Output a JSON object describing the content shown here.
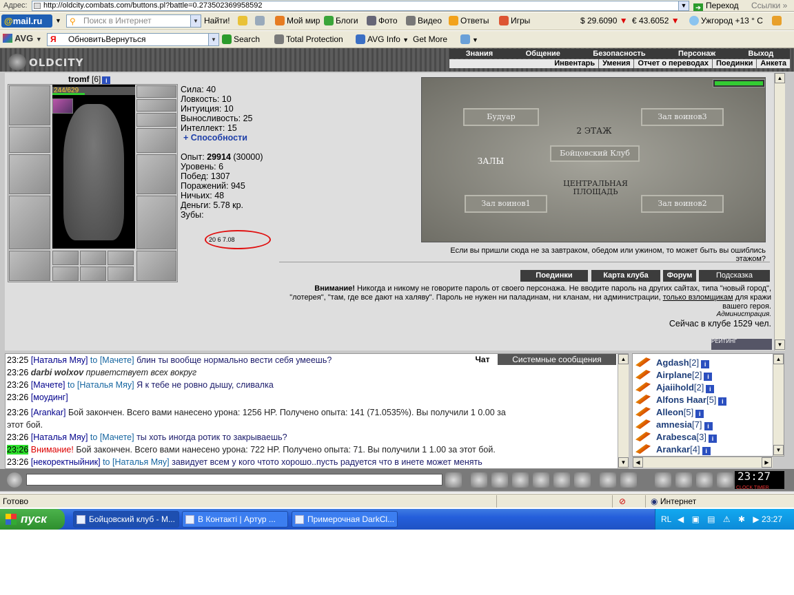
{
  "browser": {
    "address_label": "Адрес:",
    "url": "http://oldcity.combats.com/buttons.pl?battle=0.273502369958592",
    "go_label": "Переход",
    "links_label": "Ссылки"
  },
  "toolbar1": {
    "mailru_text": "mail.ru",
    "search_placeholder": "Поиск в Интернет",
    "find_button": "Найти!",
    "items": [
      "Мой мир",
      "Блоги",
      "Фото",
      "Видео",
      "Ответы",
      "Игры"
    ],
    "usd": "$ 29.6090",
    "eur": "€ 43.6052",
    "weather": "Ужгород +13 ° C"
  },
  "toolbar2": {
    "avg": "AVG",
    "yandex_text": "ОбновитьВернуться",
    "search": "Search",
    "total_protection": "Total Protection",
    "avg_info": "AVG Info",
    "get_more": "Get More"
  },
  "game": {
    "logo": "OLDCITY",
    "top_nav": [
      "Знания",
      "Общение",
      "Безопасность",
      "Персонаж",
      "Выход"
    ],
    "sub_nav": [
      "Инвентарь",
      "Умения",
      "Отчет о переводах",
      "Поединки",
      "Анкета"
    ],
    "character": {
      "name": "tromf",
      "level_tag": "[6]",
      "hp": "244/629",
      "hp_fraction": 0.388,
      "stats": [
        "Сила: 40",
        "Ловкость: 10",
        "Интуиция: 10",
        "Выносливость: 25",
        "Интеллект: 15"
      ],
      "abilities_link": "+ Способности",
      "exp_label": "Опыт: ",
      "exp_value": "29914",
      "exp_next": " (30000)",
      "details": [
        "Уровень: 6",
        "Побед: 1307",
        "Поражений: 945",
        "Ничьих: 48",
        "Деньги: 5.78 кр."
      ],
      "teeth_label": "Зубы:",
      "teeth_value": "20 6 7.08"
    },
    "map": {
      "rooms": [
        "Будуар",
        "Зал воинов3",
        "2 ЭТАЖ",
        "Бойцовский Клуб",
        "ЗАЛЫ",
        "ЦЕНТРАЛЬНАЯ ПЛОЩАДЬ",
        "Зал воинов1",
        "Зал воинов2"
      ],
      "caption": "Если вы пришли сюда не за завтраком, обедом или ужином, то может быть вы ошиблись этажом?"
    },
    "buttons": [
      "Поединки",
      "Карта клуба",
      "Форум",
      "Подсказка"
    ],
    "warning_bold": "Внимание!",
    "warning_text": " Никогда и никому не говорите пароль от своего персонажа. Не вводите пароль на других сайтах, типа \"новый город\", \"лотерея\", \"там, где все дают на халяву\". Пароль не нужен ни паладинам, ни кланам, ни администрации, ",
    "warning_link": "только взломщикам",
    "warning_end": " для кражи вашего героя.",
    "admin_sign": "Администрация.",
    "online": "Сейчас в клубе 1529 чел.",
    "rating": "РЕЙТИНГ"
  },
  "chat": {
    "tab_chat": "Чат",
    "tab_system": "Системные сообщения",
    "lines": [
      {
        "time": "23:25",
        "nick": "[Наталья Мяу]",
        "to": "to [Мачете]",
        "text": " блин ты вообще нормально вести себя умеешь?"
      },
      {
        "time": "23:26",
        "nick": "darbi wolxov",
        "to": "",
        "text": " приветствует всех вокруг"
      },
      {
        "time": "23:26",
        "nick": "[Мачете]",
        "to": "to [Наталья Мяу]",
        "text": " Я к тебе не ровно дышу, сливалка"
      },
      {
        "time": "23:26",
        "nick": "[моудинг]",
        "to": "",
        "text": ""
      },
      {
        "time": "23:26",
        "nick": "[Arankar]",
        "to": "",
        "text": " Бой закончен. Всего вами нанесено урона: 1256 HP. Получено опыта: 141 (71.0535%). Вы получили 1 0.00 за"
      },
      {
        "time": "",
        "nick": "",
        "to": "",
        "text": "этот бой."
      },
      {
        "time": "23:26",
        "nick": "[Наталья Мяу]",
        "to": "to [Мачете]",
        "text": " ты хоть иногда ротик то закрываешь?"
      },
      {
        "time": "23:26",
        "nick": "Внимание!",
        "to": "",
        "text": " Бой закончен. Всего вами нанесено урона: 722 HP. Получено опыта: 71. Вы получили 1 1.00 за этот бой."
      },
      {
        "time": "23:26",
        "nick": "[некоректныйник]",
        "to": "to [Наталья Мяу]",
        "text": " завидует всем у кого чтото хорошо..пусть радуется что в инете может менять"
      },
      {
        "time": "",
        "nick": "",
        "to": "",
        "text": "себя до неузнаваемости"
      }
    ]
  },
  "users": [
    {
      "name": "Agdash",
      "level": "[2]"
    },
    {
      "name": "Airplane",
      "level": "[2]"
    },
    {
      "name": "Ajaiihold",
      "level": "[2]"
    },
    {
      "name": "Alfons Haar",
      "level": "[5]"
    },
    {
      "name": "Alleon",
      "level": "[5]"
    },
    {
      "name": "amnesia",
      "level": "[7]"
    },
    {
      "name": "Arabesca",
      "level": "[3]"
    },
    {
      "name": "Arankar",
      "level": "[4]"
    }
  ],
  "clock": {
    "time": "23:27",
    "label": "CLOCK TIMER"
  },
  "status": {
    "done": "Готово",
    "zone": "Интернет"
  },
  "taskbar": {
    "start": "пуск",
    "tasks": [
      "Бойцовский клуб - M...",
      "В Контакті | Артур ...",
      "Примерочная DarkCl..."
    ],
    "lang": "RL",
    "time": "23:27"
  }
}
